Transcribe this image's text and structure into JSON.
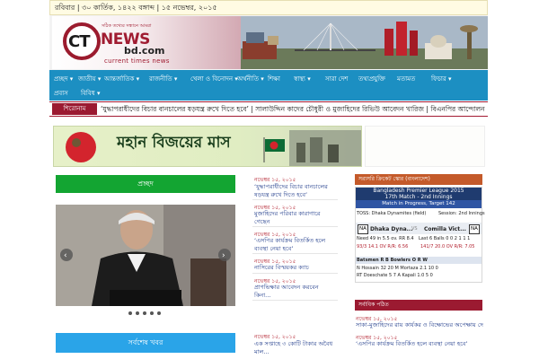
{
  "topbar": {
    "date_text": "রবিবার | ৩০ কার্তিক, ১৪২২ বঙ্গাব্দ | ১৫ নভেম্বর, ২০১৫"
  },
  "logo": {
    "ct": "CT",
    "news": "NEWS",
    "domain": "bd.com",
    "tagline": "current times news",
    "slogan": "সঠিক তথ্যের সন্ধানে আমরা"
  },
  "nav": {
    "items": [
      {
        "label": "প্রচ্ছদ",
        "icon": "chevron-down-icon"
      },
      {
        "label": "জাতীয়",
        "icon": "chevron-down-icon"
      },
      {
        "label": "আন্তর্জাতিক",
        "icon": "chevron-down-icon"
      },
      {
        "label": "রাজনীতি",
        "icon": "chevron-down-icon"
      },
      {
        "label": "খেলা ও বিনোদন",
        "icon": "chevron-down-icon"
      },
      {
        "label": "অর্থনীতি",
        "icon": "chevron-down-icon"
      },
      {
        "label": "শিক্ষা"
      },
      {
        "label": "স্বাস্থ্য",
        "icon": "chevron-down-icon"
      },
      {
        "label": "সারা দেশ"
      },
      {
        "label": "তথ্যপ্রযুক্তি"
      },
      {
        "label": "মতামত"
      },
      {
        "label": "ফিচার",
        "icon": "chevron-down-icon"
      },
      {
        "label": "প্রবাস"
      },
      {
        "label": "বিবিধ",
        "icon": "chevron-down-icon"
      }
    ]
  },
  "ticker": {
    "label": "শিরোনাম",
    "text": "‘যুদ্ধাপরাধীদের বিচার বানচালের ষড়যন্ত্র রুখে দিতে হবে’ | সালাউদ্দিন কাদের চৌধুরী ও মুজাহিদের রিভিউ আবেদন খারিজ | বিএনপির আন্দোলন..."
  },
  "promo": {
    "text": "মহান বিজয়ের মাস"
  },
  "left": {
    "green_heading": "প্রচ্ছদ",
    "blue_heading": "সর্বশেষ খবর",
    "slider_dots": 5
  },
  "middle_news": [
    {
      "date": "নভেম্বর ১৫, ২০১৫",
      "title": "‘যুদ্ধাপরাধীদের বিচার বানচালের ষড়যন্ত্র রুখে দিতে হবে’"
    },
    {
      "date": "নভেম্বর ১৫, ২০১৫",
      "title": "মুজাহিদের পরিবার কারাগারে গেছেন"
    },
    {
      "date": "নভেম্বর ১৫, ২০১৫",
      "title": "‘এসপির কার্যক্রম বিতর্কিত হলে ব্যবস্থা নেয়া হবে’"
    },
    {
      "date": "নভেম্বর ১৫, ২০১৫",
      "title": "নাসিরের বিস্ময়কর ক্যাচ"
    },
    {
      "date": "নভেম্বর ১৫, ২০১৫",
      "title": "প্রাণভিক্ষার আবেদন করবেন কিনা..."
    },
    {
      "date": "নভেম্বর ১৫, ২০১৫",
      "title": "এক সপ্তাহে ৩ কোটি টাকার অবৈধ মাল..."
    }
  ],
  "cricket": {
    "heading": "সরাসরি ক্রিকেট স্কোর (বাংলাদেশ)",
    "title": "Bangladesh Premier League 2015",
    "subtitle": "17th Match - 2nd Innings",
    "status": "Match in Progress, Target 142",
    "toss": "TOSS: Dhaka Dynamites (field)",
    "session": "Session: 2nd Innings",
    "team1_badge": "NA",
    "team1": "Dhaka Dyna...",
    "vs": "VS",
    "team2": "Comilla Vict...",
    "team2_badge": "NA",
    "need": "Need 49 in 5.5 ov. RR 8.4",
    "last6": "Last 6 Balls   0 0 2 1 1 1",
    "score1": "93/3   14.1 OV   R/R: 6.56",
    "score2": "141/7   20.0 OV   R/R: 7.05",
    "bat_header": "Batsmen    R   B   Bowlers    O   R   W",
    "bat1": "N Hossain   32  20   M Mortaza  2.1  10  0",
    "bat2": "RT Doeschate  5   7   A Kapali   1.0   5  0"
  },
  "recent": {
    "heading": "সর্বাধিক পঠিত",
    "items": [
      {
        "date": "নভেম্বর ১৫, ২০১৫",
        "title": "সাকা-মুজাহিদের রায় কার্যকর ও বিক্ষোভের অপেক্ষায় দেশ"
      },
      {
        "date": "নভেম্বর ১৫, ২০১৫",
        "title": "‘এসপির কার্যক্রম বিতর্কিত হলে ব্যবস্থা নেয়া হবে’"
      }
    ]
  },
  "colors": {
    "nav_bg": "#1c8fc2",
    "brand_red": "#9b1a31",
    "green": "#13a532",
    "blue": "#2aa4e8"
  }
}
